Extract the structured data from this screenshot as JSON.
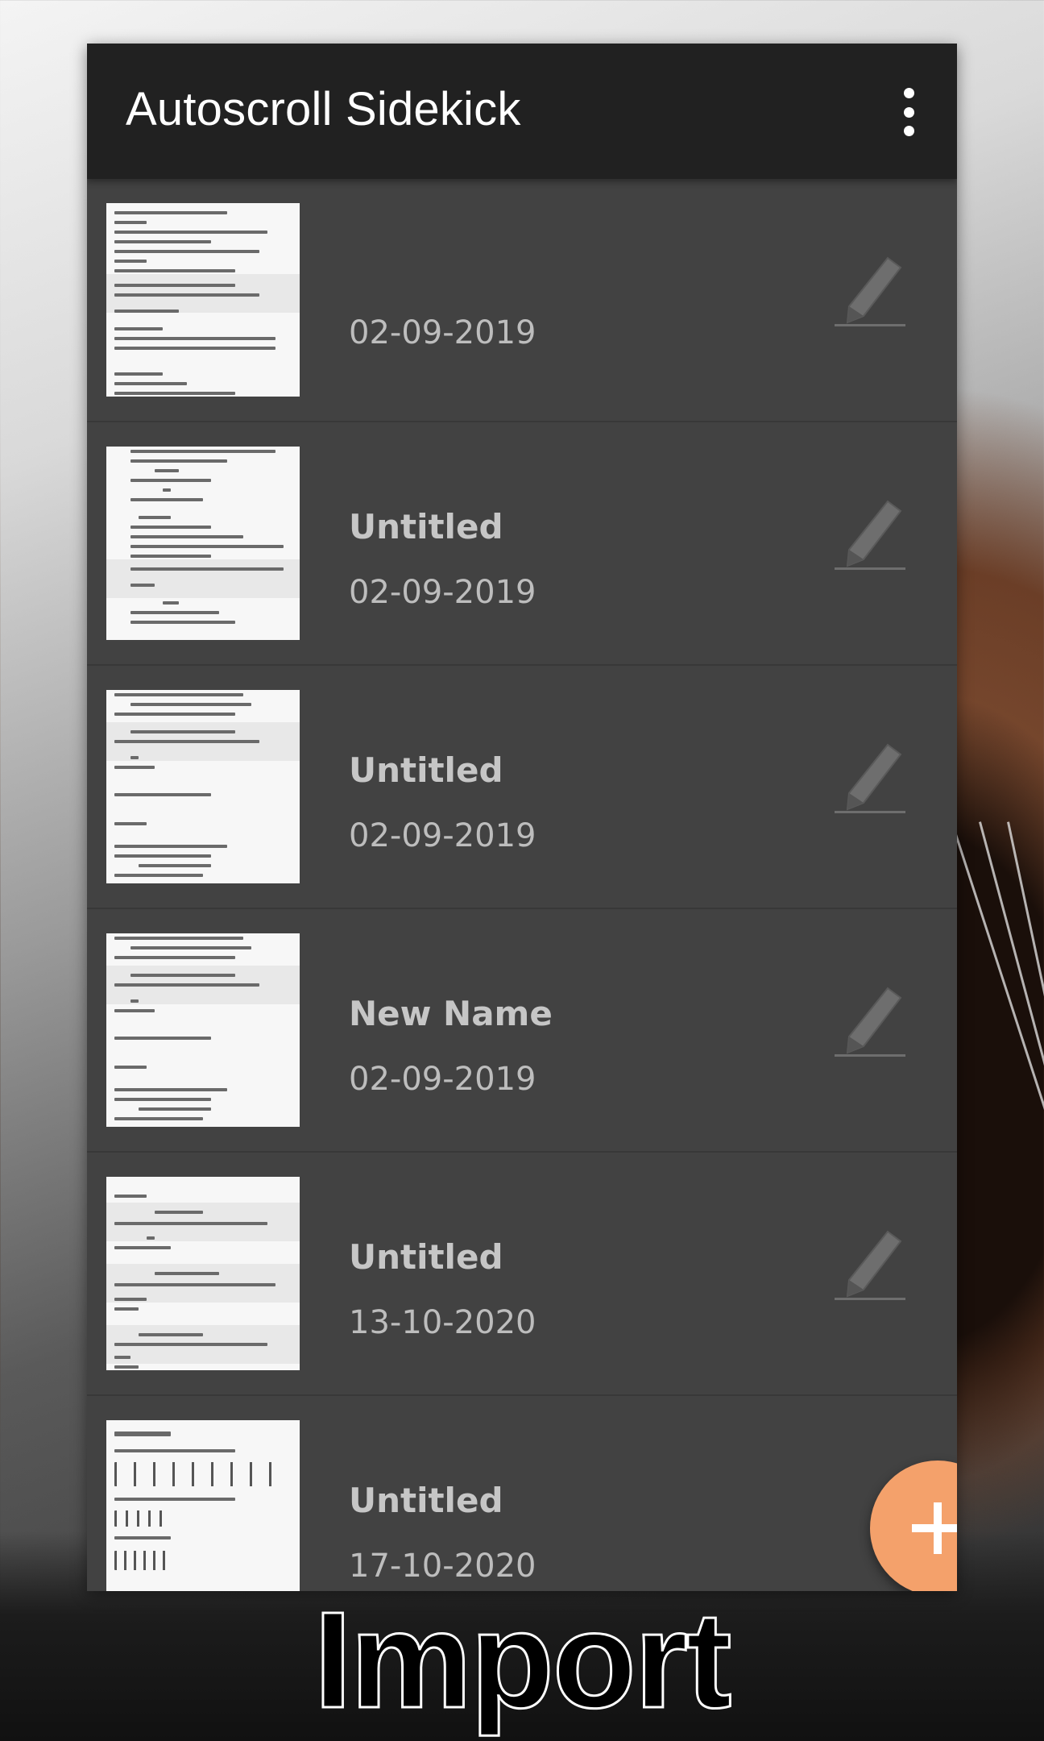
{
  "app": {
    "title": "Autoscroll Sidekick",
    "menu_icon": "overflow-menu-icon"
  },
  "songs": [
    {
      "name": "",
      "date": "02-09-2019"
    },
    {
      "name": "Untitled",
      "date": "02-09-2019"
    },
    {
      "name": "Untitled",
      "date": "02-09-2019"
    },
    {
      "name": "New Name",
      "date": "02-09-2019"
    },
    {
      "name": "Untitled",
      "date": "13-10-2020"
    },
    {
      "name": "Untitled",
      "date": "17-10-2020"
    }
  ],
  "row_icon": "pencil-edit-icon",
  "fab": {
    "icon": "plus-icon",
    "color": "#f4a16b"
  },
  "caption": "Import",
  "colors": {
    "appbar": "#212121",
    "list_background": "#424242",
    "accent": "#f4a16b"
  }
}
